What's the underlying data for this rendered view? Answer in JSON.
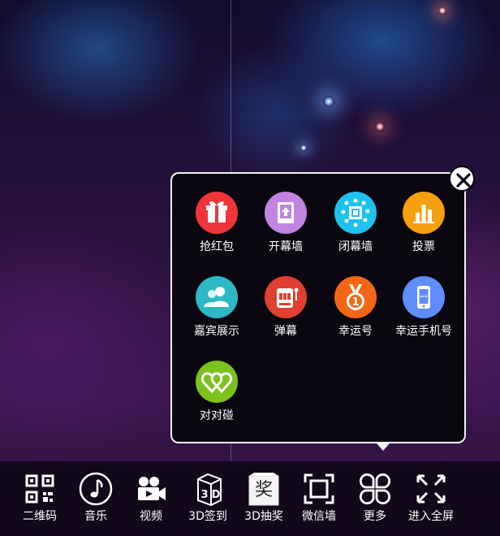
{
  "popup": {
    "items": [
      {
        "label": "抢红包",
        "icon": "gift-icon",
        "color": "#f0353b"
      },
      {
        "label": "开幕墙",
        "icon": "open-wall-icon",
        "color": "#c184e0"
      },
      {
        "label": "闭幕墙",
        "icon": "close-wall-icon",
        "color": "#1ec2ee"
      },
      {
        "label": "投票",
        "icon": "vote-chart-icon",
        "color": "#f5a00f"
      },
      {
        "label": "嘉宾展示",
        "icon": "guests-icon",
        "color": "#2cb8c4"
      },
      {
        "label": "弹幕",
        "icon": "slot-machine-icon",
        "color": "#e0402f"
      },
      {
        "label": "幸运号",
        "icon": "medal-icon",
        "color": "#f56614"
      },
      {
        "label": "幸运手机号",
        "icon": "phone-icon",
        "color": "#5f8dfa"
      },
      {
        "label": "对对碰",
        "icon": "hearts-icon",
        "color": "#7cc21c"
      }
    ]
  },
  "toolbar": {
    "items": [
      {
        "label": "二维码",
        "icon": "qr-code-icon"
      },
      {
        "label": "音乐",
        "icon": "music-note-icon"
      },
      {
        "label": "视频",
        "icon": "video-camera-icon"
      },
      {
        "label": "3D签到",
        "icon": "3d-cube-icon"
      },
      {
        "label": "3D抽奖",
        "icon": "prize-icon",
        "icon_text": "奖"
      },
      {
        "label": "微信墙",
        "icon": "wall-frame-icon"
      },
      {
        "label": "更多",
        "icon": "more-petals-icon"
      },
      {
        "label": "进入全屏",
        "icon": "fullscreen-icon"
      }
    ]
  }
}
